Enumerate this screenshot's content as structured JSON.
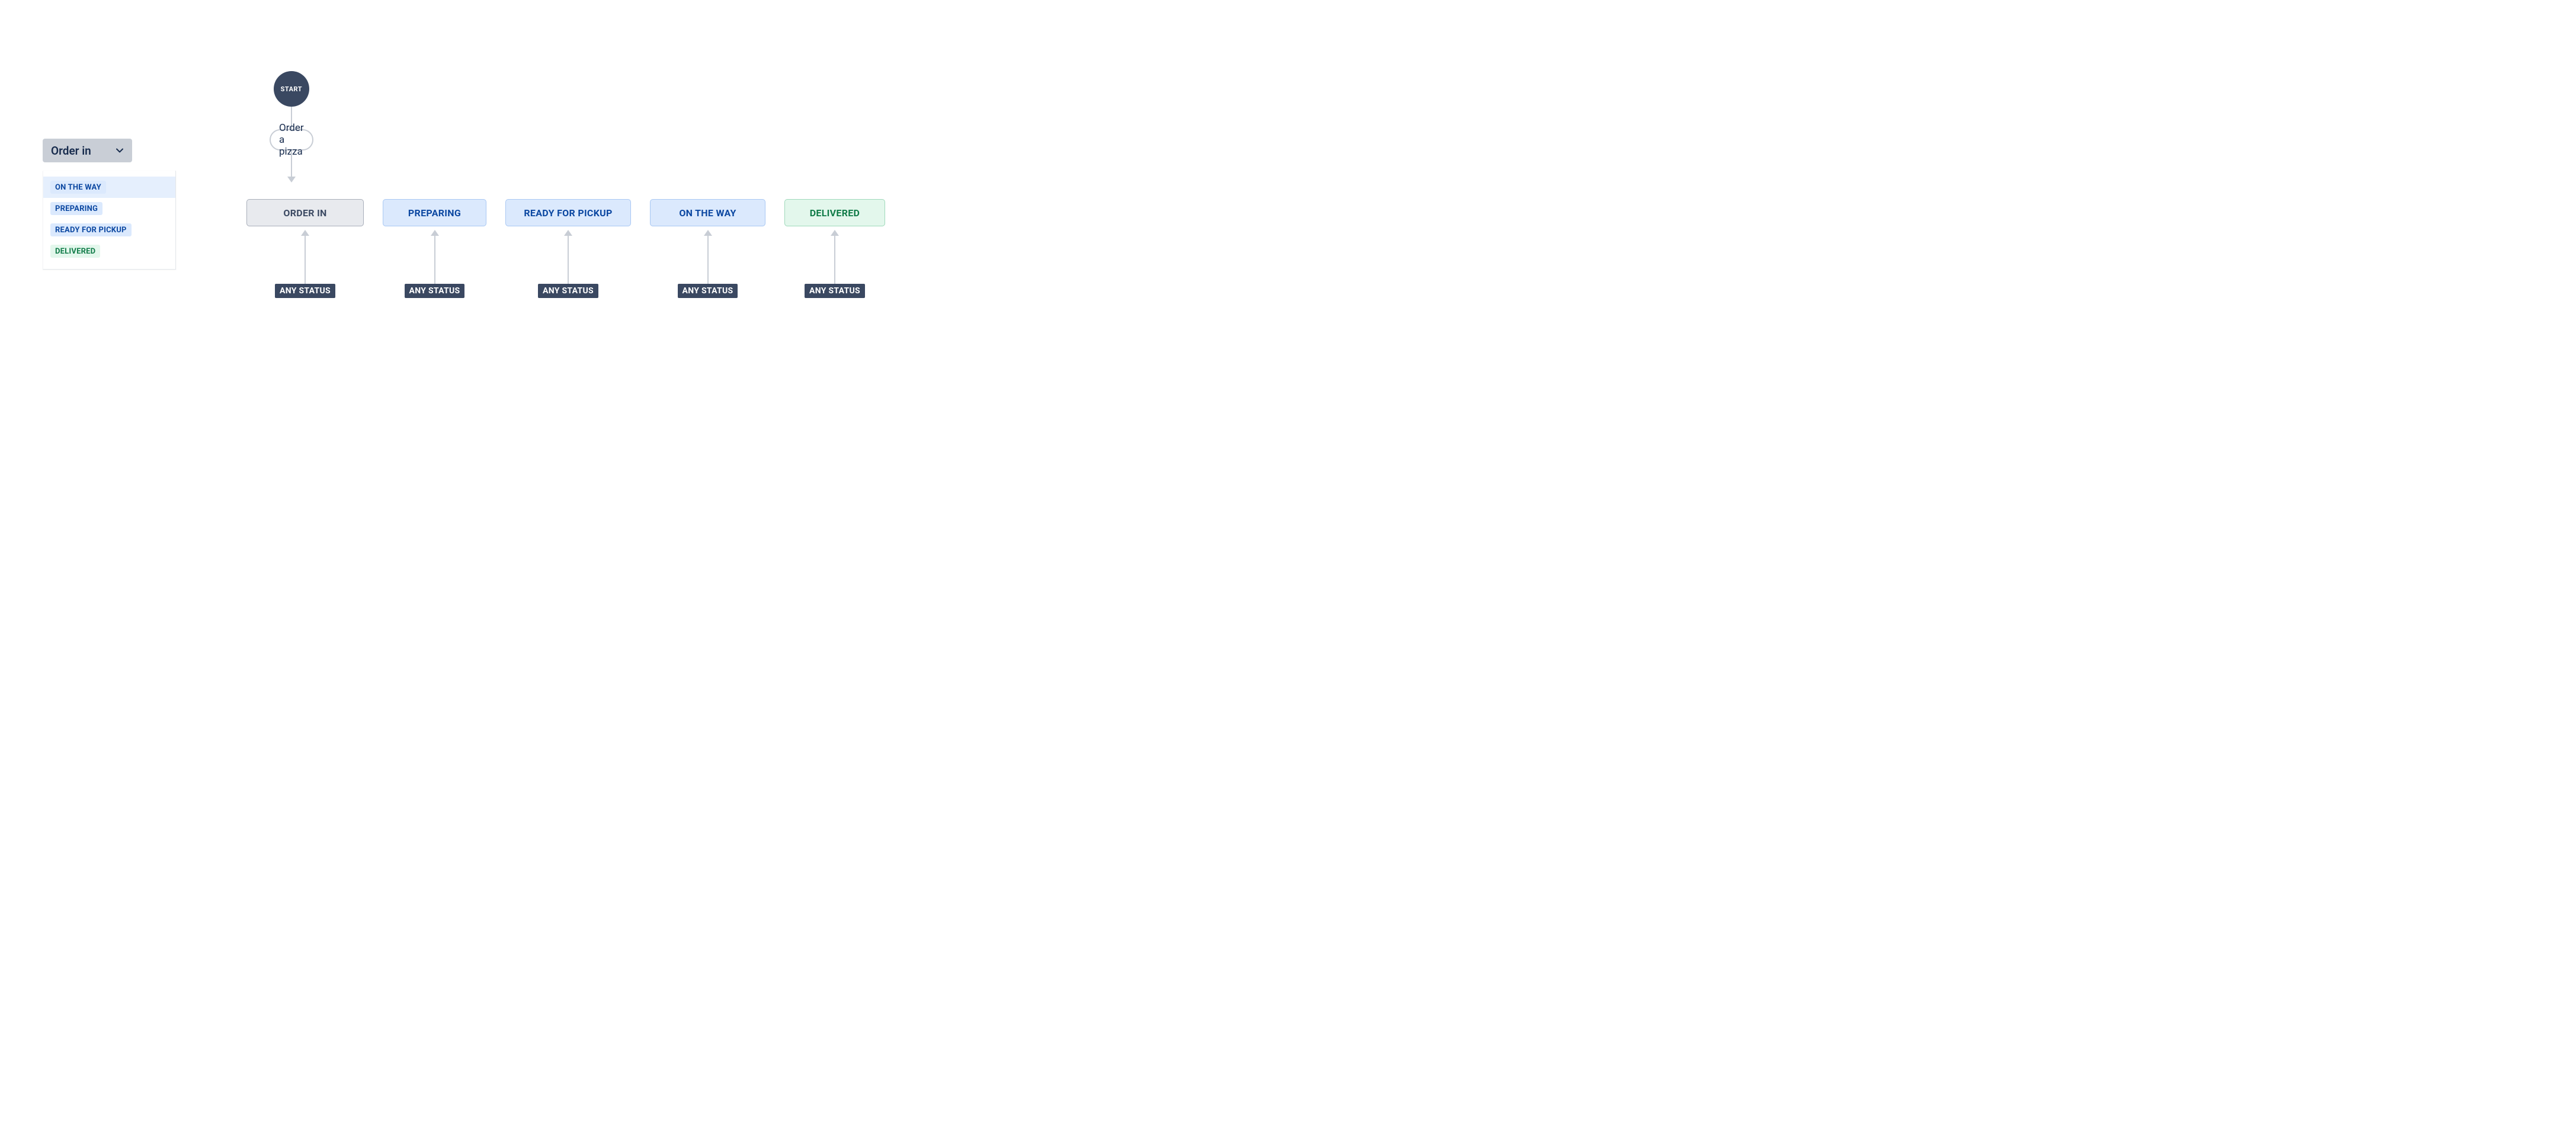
{
  "sidebar": {
    "dropdown_label": "Order in",
    "items": [
      {
        "label": "ON THE WAY",
        "color": "blue",
        "selected": true
      },
      {
        "label": "PREPARING",
        "color": "blue",
        "selected": false
      },
      {
        "label": "READY FOR PICKUP",
        "color": "blue",
        "selected": false
      },
      {
        "label": "DELIVERED",
        "color": "green",
        "selected": false
      }
    ]
  },
  "workflow": {
    "start_label": "START",
    "transition_label": "Order a pizza",
    "any_status_label": "ANY STATUS",
    "states": [
      {
        "label": "ORDER IN",
        "style": "grey"
      },
      {
        "label": "PREPARING",
        "style": "blue"
      },
      {
        "label": "READY FOR PICKUP",
        "style": "blue wide"
      },
      {
        "label": "ON THE WAY",
        "style": "blue long"
      },
      {
        "label": "DELIVERED",
        "style": "green"
      }
    ]
  }
}
